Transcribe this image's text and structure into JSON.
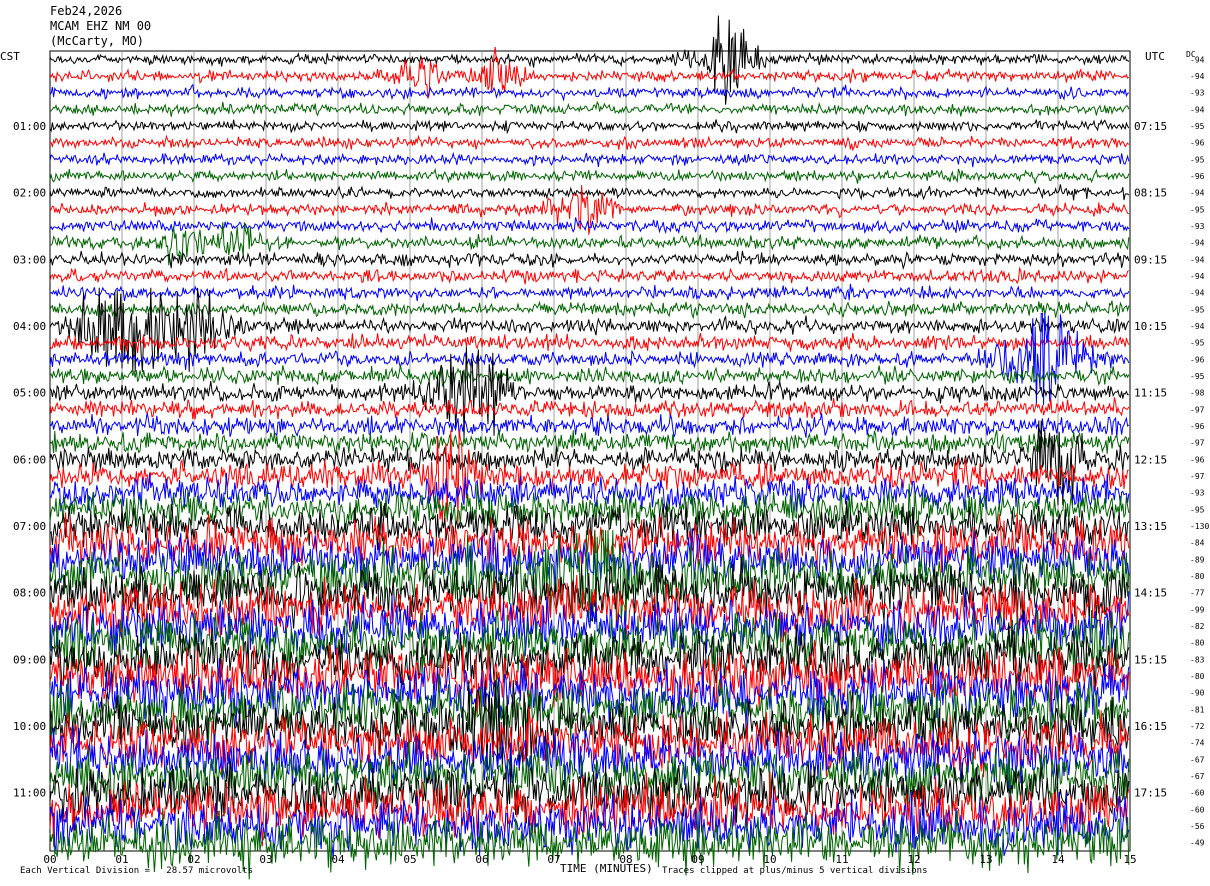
{
  "header": {
    "date": "Feb24,2026",
    "station": "MCAM EHZ NM 00",
    "location": "(McCarty, MO)"
  },
  "left_axis_label": "CST",
  "right_axis_label": "UTC",
  "dc_label": "DC",
  "footer": {
    "scale_note": "Each Vertical Division =   28.57 microvolts",
    "clip_note": "Traces clipped at plus/minus 5 vertical divisions",
    "xlabel": "TIME (MINUTES)"
  },
  "chart_data": {
    "type": "line",
    "title": "",
    "xlabel": "TIME (MINUTES)",
    "xlim": [
      0,
      15
    ],
    "x_ticks": [
      "00",
      "01",
      "02",
      "03",
      "04",
      "05",
      "06",
      "07",
      "08",
      "09",
      "10",
      "11",
      "12",
      "13",
      "14",
      "15"
    ],
    "left_time_labels": [
      "01:00",
      "02:00",
      "03:00",
      "04:00",
      "05:00",
      "06:00",
      "07:00",
      "08:00",
      "09:00",
      "10:00",
      "11:00"
    ],
    "right_time_labels": [
      "07:15",
      "08:15",
      "09:15",
      "10:15",
      "11:15",
      "12:15",
      "13:15",
      "14:15",
      "15:15",
      "16:15",
      "17:15"
    ],
    "trace_colors": [
      "#000000",
      "#ff0000",
      "#0000ff",
      "#006400"
    ],
    "num_traces": 48,
    "dc_offsets": [
      -94,
      -94,
      -93,
      -94,
      -95,
      -96,
      -95,
      -96,
      -94,
      -95,
      -93,
      -94,
      -94,
      -94,
      -94,
      -95,
      -94,
      -95,
      -96,
      -95,
      -98,
      -97,
      -96,
      -97,
      -96,
      -97,
      -93,
      -95,
      -130,
      -84,
      -89,
      -80,
      -77,
      -99,
      -82,
      -80,
      -83,
      -80,
      -90,
      -81,
      -72,
      -74,
      -67,
      -67,
      -60,
      -60,
      -56,
      -49
    ],
    "amplitude_levels": [
      1.0,
      1.0,
      1.0,
      1.0,
      1.0,
      1.0,
      1.0,
      1.0,
      1.0,
      1.1,
      1.1,
      1.2,
      1.2,
      1.2,
      1.2,
      1.3,
      1.3,
      1.4,
      1.4,
      1.5,
      1.6,
      1.7,
      1.8,
      1.9,
      2.2,
      2.6,
      3.0,
      3.4,
      3.8,
      4.2,
      4.5,
      4.8,
      5.0,
      5.0,
      5.0,
      5.0,
      5.0,
      5.0,
      5.0,
      5.0,
      5.0,
      5.0,
      5.0,
      5.0,
      5.0,
      5.0,
      5.0,
      5.0
    ],
    "events": [
      {
        "trace": 0,
        "minute": 9.4,
        "amplitude": 5.0,
        "duration": 0.6
      },
      {
        "trace": 1,
        "minute": 5.0,
        "amplitude": 2.0,
        "duration": 0.6
      },
      {
        "trace": 1,
        "minute": 6.3,
        "amplitude": 2.0,
        "duration": 0.6
      },
      {
        "trace": 9,
        "minute": 7.4,
        "amplitude": 2.5,
        "duration": 0.6
      },
      {
        "trace": 11,
        "minute": 1.8,
        "amplitude": 1.8,
        "duration": 0.5
      },
      {
        "trace": 11,
        "minute": 2.6,
        "amplitude": 1.8,
        "duration": 0.5
      },
      {
        "trace": 16,
        "minute": 1.0,
        "amplitude": 5.0,
        "duration": 0.9
      },
      {
        "trace": 16,
        "minute": 2.0,
        "amplitude": 4.0,
        "duration": 0.7
      },
      {
        "trace": 18,
        "minute": 13.8,
        "amplitude": 5.0,
        "duration": 0.8
      },
      {
        "trace": 20,
        "minute": 5.8,
        "amplitude": 4.0,
        "duration": 0.8
      },
      {
        "trace": 24,
        "minute": 14.0,
        "amplitude": 4.0,
        "duration": 0.6
      },
      {
        "trace": 25,
        "minute": 5.6,
        "amplitude": 4.0,
        "duration": 0.6
      },
      {
        "trace": 31,
        "minute": 7.5,
        "amplitude": 5.0,
        "duration": 0.8
      },
      {
        "trace": 40,
        "minute": 6.2,
        "amplitude": 5.0,
        "duration": 0.8
      }
    ]
  }
}
